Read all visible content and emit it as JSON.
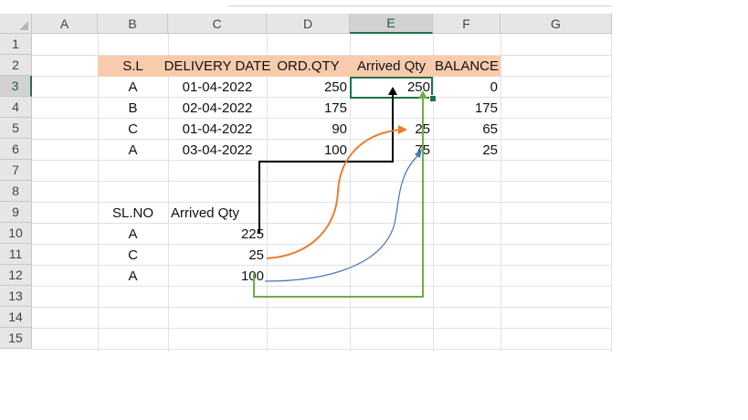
{
  "columns": [
    "A",
    "B",
    "C",
    "D",
    "E",
    "F",
    "G"
  ],
  "rows": [
    "1",
    "2",
    "3",
    "4",
    "5",
    "6",
    "7",
    "8",
    "9",
    "10",
    "11",
    "12",
    "13",
    "14",
    "15"
  ],
  "selected_column": "E",
  "selected_row": "3",
  "table": {
    "headers": [
      "S.L",
      "DELIVERY DATE",
      "ORD.QTY",
      "Arrived Qty",
      "BALANCE"
    ],
    "header_fill": "#f8cbad",
    "rows": [
      {
        "sl": "A",
        "date": "01-04-2022",
        "ord": "250",
        "arrived": "250",
        "balance": "0"
      },
      {
        "sl": "B",
        "date": "02-04-2022",
        "ord": "175",
        "arrived": "",
        "balance": "175"
      },
      {
        "sl": "C",
        "date": "01-04-2022",
        "ord": "90",
        "arrived": "25",
        "balance": "65"
      },
      {
        "sl": "A",
        "date": "03-04-2022",
        "ord": "100",
        "arrived": "75",
        "balance": "25"
      }
    ]
  },
  "lookup": {
    "headers": [
      "SL.NO",
      "Arrived Qty"
    ],
    "rows": [
      {
        "sl": "A",
        "qty": "225"
      },
      {
        "sl": "C",
        "qty": "25"
      },
      {
        "sl": "A",
        "qty": "100"
      }
    ]
  },
  "arrows": [
    {
      "from_row": "10",
      "to_cell": "E3",
      "color": "#000000"
    },
    {
      "from_row": "11",
      "to_cell": "E5",
      "color": "#ed7d31"
    },
    {
      "from_row": "12",
      "to_cell": "E6",
      "color": "#4472c4"
    },
    {
      "from_row": "12",
      "to_cell": "E6",
      "color": "#70ad47"
    }
  ],
  "colors": {
    "selection": "#217346",
    "header_bg": "#e6e6e6",
    "gridline": "#e2e2e2"
  }
}
